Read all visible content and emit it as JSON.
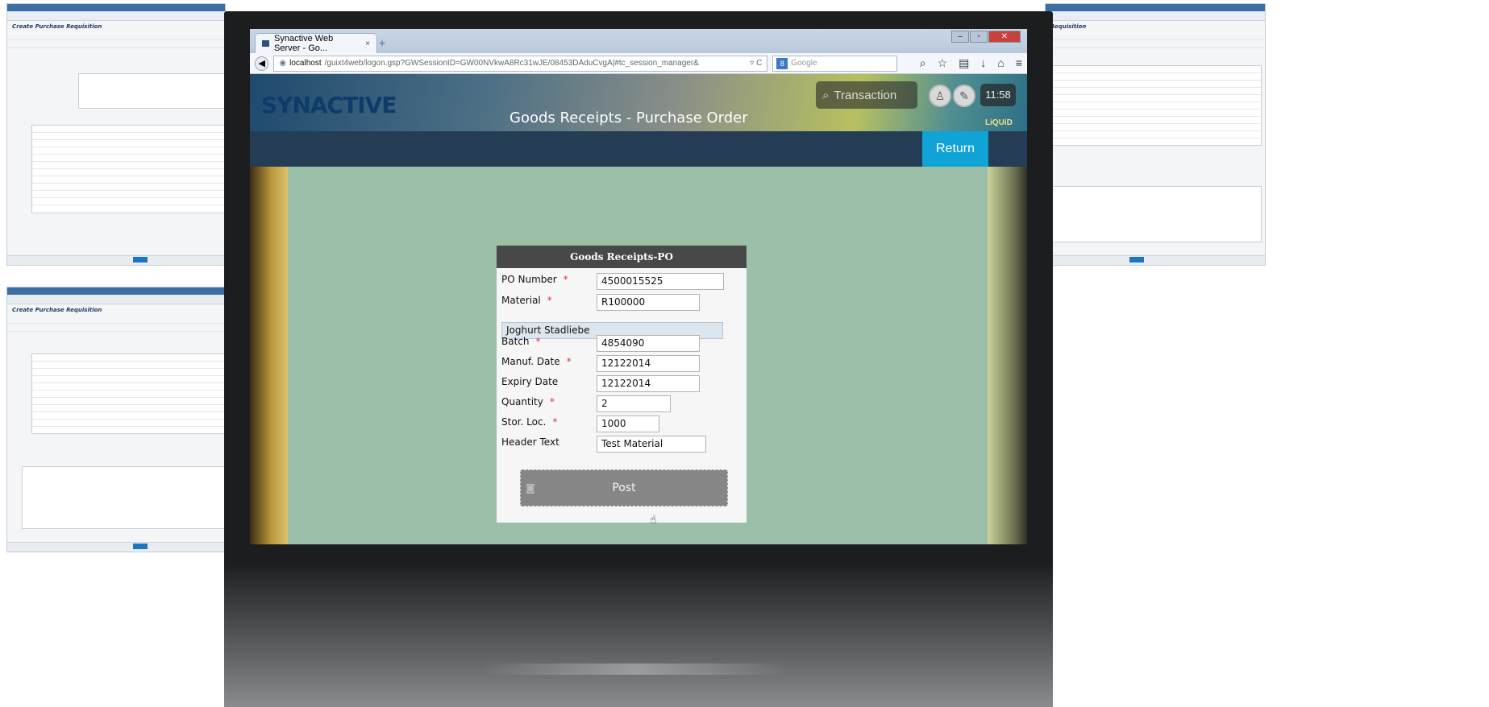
{
  "background_windows": {
    "sap_heading": "Create Purchase Requisition",
    "sap_heading_right": "Requisition"
  },
  "browser": {
    "tab_title": "Synactive Web Server - Go...",
    "tab_close": "×",
    "new_tab": "+",
    "url_host": "localhost",
    "url_rest": "/guixt4web/logon.gsp?GWSessionID=GW00NVkwA8Rc31wJE/08453DAduCvgA|#tc_session_manager&",
    "url_tools": "▿ C",
    "search_placeholder": "Google",
    "search_engine": "8"
  },
  "app": {
    "logo": "SYNACTIVE",
    "page_title": "Goods Receipts - Purchase Order",
    "transaction_placeholder": "Transaction",
    "clock": "11:58",
    "liquid_badge": "LiQUiD",
    "return_label": "Return"
  },
  "form": {
    "header": "Goods Receipts-PO",
    "required_mark": "*",
    "fields": [
      {
        "label": "PO Number",
        "value": "4500015525",
        "required": true
      },
      {
        "label": "Material",
        "value": "R100000",
        "required": true
      },
      {
        "label": "Batch",
        "value": "4854090",
        "required": true
      },
      {
        "label": "Manuf. Date",
        "value": "12122014",
        "required": true
      },
      {
        "label": "Expiry Date",
        "value": "12122014",
        "required": false
      },
      {
        "label": "Quantity",
        "value": "2",
        "required": true
      },
      {
        "label": "Stor. Loc.",
        "value": "1000",
        "required": true
      },
      {
        "label": "Header Text",
        "value": "Test Material",
        "required": false
      }
    ],
    "material_description": "Joghurt Stadliebe",
    "post_label": "Post"
  },
  "icons": [
    "search-icon",
    "camera-icon",
    "cursor-icon",
    "back-icon",
    "star-icon",
    "home-icon",
    "download-icon",
    "menu-icon",
    "user-icon",
    "wrench-icon"
  ]
}
